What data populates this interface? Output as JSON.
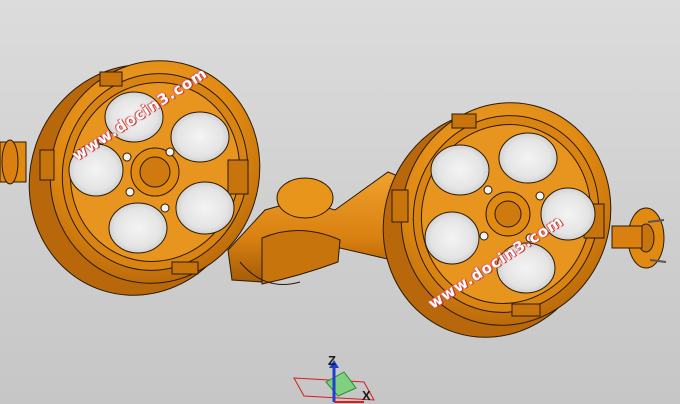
{
  "viewport": {
    "background_top": "#dcdcdc",
    "background_bottom": "#c6c6c6",
    "part_color": "#e08a12",
    "part_shadow": "#a9600a",
    "part_edge": "#2a1a05"
  },
  "watermarks": [
    "www.docin3.com",
    "www.docin3.com"
  ],
  "triad": {
    "z_label": "Z",
    "x_label": "X",
    "icon": "axis-triad-icon"
  }
}
